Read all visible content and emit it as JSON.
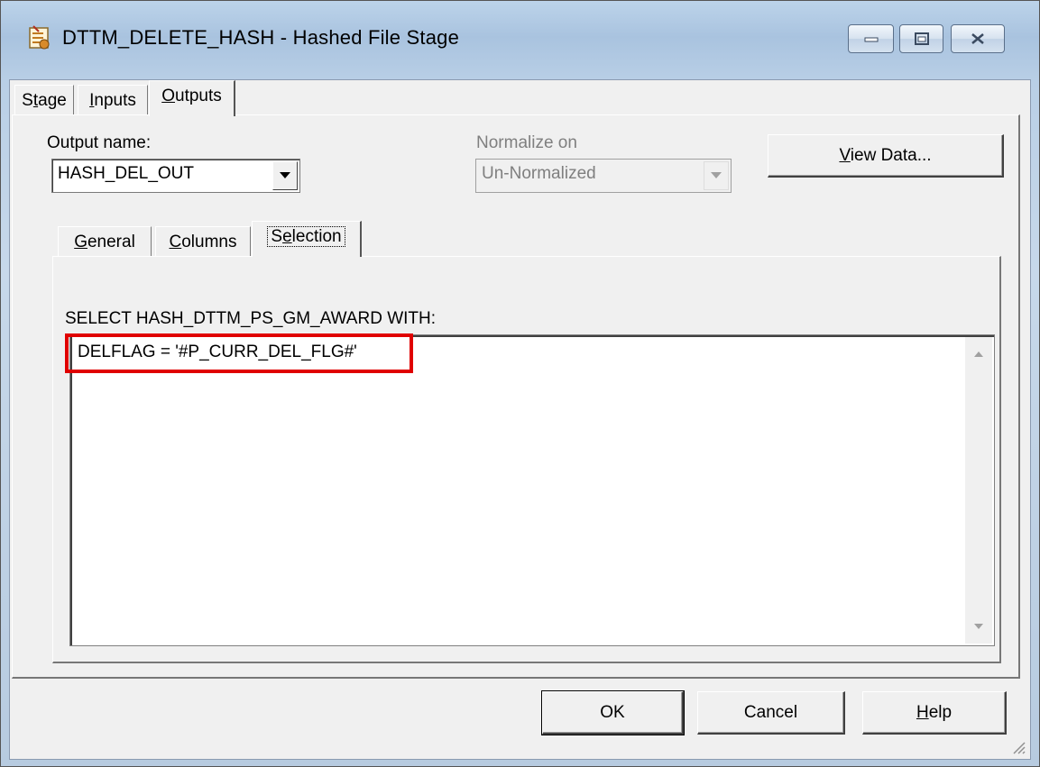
{
  "window": {
    "title": "DTTM_DELETE_HASH - Hashed File Stage",
    "icon": "stage-icon"
  },
  "main_tabs": [
    {
      "label": "Stage",
      "mnemonic": "t",
      "active": false
    },
    {
      "label": "Inputs",
      "mnemonic": "I",
      "active": false
    },
    {
      "label": "Outputs",
      "mnemonic": "O",
      "active": true
    }
  ],
  "output": {
    "label": "Output name:",
    "value": "HASH_DEL_OUT"
  },
  "normalize": {
    "label": "Normalize on",
    "value": "Un-Normalized",
    "enabled": false
  },
  "view_data_label": "View Data...",
  "sub_tabs": [
    {
      "label": "General",
      "mnemonic": "G",
      "active": false
    },
    {
      "label": "Columns",
      "mnemonic": "C",
      "active": false
    },
    {
      "label": "Selection",
      "mnemonic": "e",
      "active": true
    }
  ],
  "selection": {
    "heading": "SELECT HASH_DTTM_PS_GM_AWARD WITH:",
    "expression": "DELFLAG = '#P_CURR_DEL_FLG#'",
    "highlight_color": "#e00000"
  },
  "buttons": {
    "ok": "OK",
    "cancel": "Cancel",
    "help": "Help"
  }
}
